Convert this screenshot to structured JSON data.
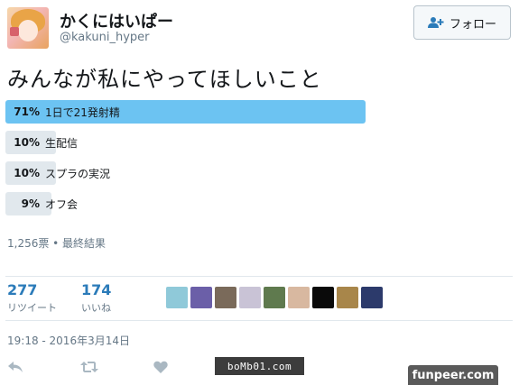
{
  "tweet": {
    "display_name": "かくにはいぱー",
    "screen_name": "@kakuni_hyper",
    "text": "みんなが私にやってほしいこと"
  },
  "follow_button": {
    "label": "フォロー",
    "icon": "add-user-icon"
  },
  "poll": {
    "options": [
      {
        "percent_label": "71%",
        "label": "1日で21発射精",
        "percent": 71,
        "winner": true
      },
      {
        "percent_label": "10%",
        "label": "生配信",
        "percent": 10,
        "winner": false
      },
      {
        "percent_label": "10%",
        "label": "スプラの実況",
        "percent": 10,
        "winner": false
      },
      {
        "percent_label": "9%",
        "label": "オフ会",
        "percent": 9,
        "winner": false
      }
    ],
    "meta": "1,256票 • 最終結果"
  },
  "stats": {
    "retweets": {
      "count": "277",
      "label": "リツイート"
    },
    "likes": {
      "count": "174",
      "label": "いいね"
    }
  },
  "likers": [
    {
      "name": "liker-avatar",
      "color": "#8fc9d9"
    },
    {
      "name": "liker-avatar",
      "color": "#6b5fa8"
    },
    {
      "name": "liker-avatar",
      "color": "#7a6a5a"
    },
    {
      "name": "liker-avatar",
      "color": "#c9c3d6"
    },
    {
      "name": "liker-avatar",
      "color": "#5f7a4e"
    },
    {
      "name": "liker-avatar",
      "color": "#d8b8a0"
    },
    {
      "name": "liker-avatar",
      "color": "#0a0a0a"
    },
    {
      "name": "liker-avatar",
      "color": "#a8864a"
    },
    {
      "name": "liker-avatar",
      "color": "#2c3a6b"
    }
  ],
  "timestamp": "19:18 - 2016年3月14日",
  "actions": [
    {
      "name": "reply-icon"
    },
    {
      "name": "retweet-icon"
    },
    {
      "name": "like-icon"
    }
  ],
  "watermarks": {
    "bomb": "boMb01.com",
    "funpeer": "funpeer.com"
  },
  "colors": {
    "winner_bar": "#6cc3f2",
    "other_bar": "#e1e8ed",
    "link": "#2b7bb9",
    "muted": "#657786"
  }
}
